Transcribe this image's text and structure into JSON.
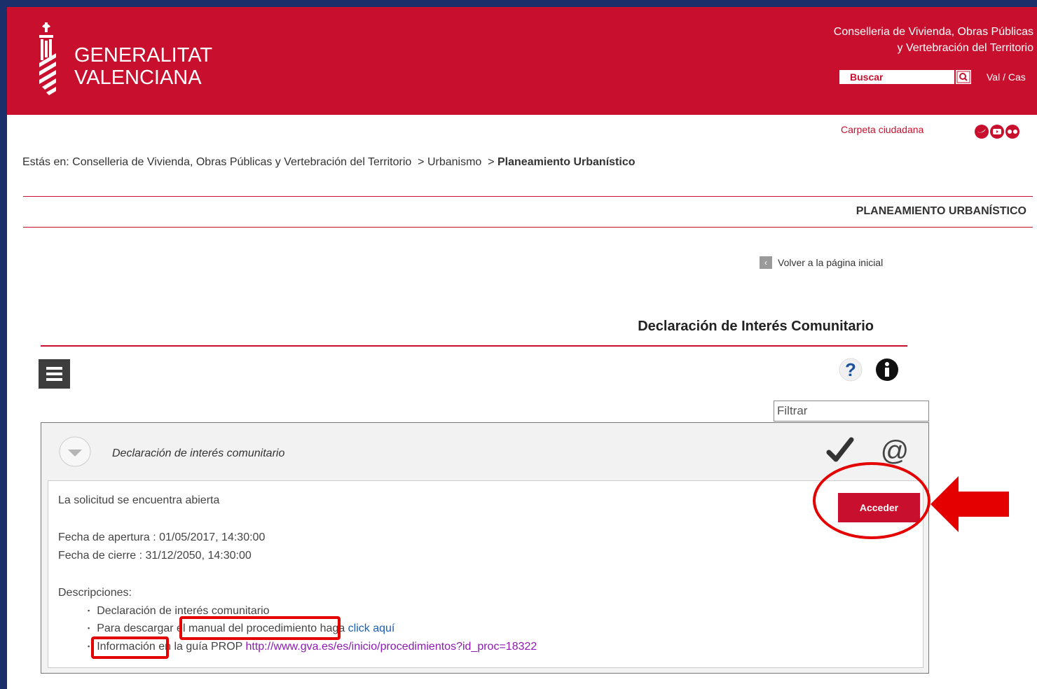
{
  "header": {
    "logo_line1": "GENERALITAT",
    "logo_line2": "VALENCIANA",
    "conselleria_line1": "Conselleria de Vivienda, Obras Públicas",
    "conselleria_line2": "y Vertebración del Territorio",
    "search_value": "Buscar",
    "lang": "Val / Cas"
  },
  "subheader": {
    "carpeta": "Carpeta ciudadana"
  },
  "breadcrumb": {
    "prefix": "Estás en:",
    "item1": "Conselleria de Vivienda, Obras Públicas y Vertebración del Territorio",
    "sep": ">",
    "item2": "Urbanismo",
    "item3": "Planeamiento Urbanístico"
  },
  "section_title": "PLANEAMIENTO URBANÍSTICO",
  "volver": "Volver a la página inicial",
  "procedure_title": "Declaración de Interés Comunitario",
  "filter_value": "Filtrar",
  "panel": {
    "title": "Declaración de interés comunitario",
    "status": "La solicitud se encuentra abierta",
    "apertura": "Fecha de apertura : 01/05/2017, 14:30:00",
    "cierre": "Fecha de cierre : 31/12/2050, 14:30:00",
    "descripciones": "Descripciones:",
    "bullet1": "Declaración de interés comunitario",
    "bullet2_a": "Para descargar",
    "bullet2_b": "el manual del procedimiento",
    "bullet2_c": "haga",
    "bullet2_link": "click aquí",
    "bullet3_a": "Información",
    "bullet3_b": "en la guía PROP",
    "bullet3_link": "http://www.gva.es/es/inicio/procedimientos?id_proc=18322",
    "acceder": "Acceder"
  },
  "colors": {
    "brand": "#c8102e",
    "annotation": "#e50000",
    "outer_bg": "#1b2f6b"
  }
}
